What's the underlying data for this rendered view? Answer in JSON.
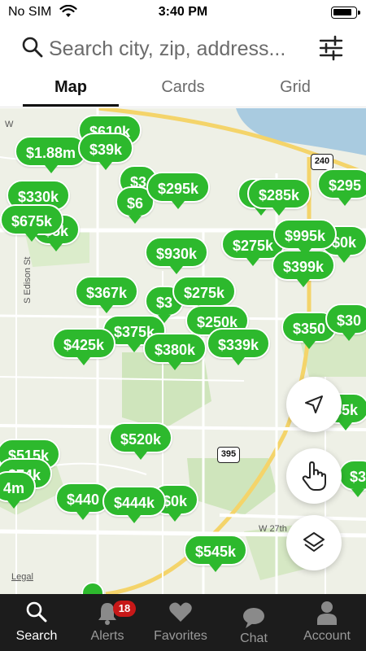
{
  "status_bar": {
    "carrier": "No SIM",
    "time": "3:40 PM"
  },
  "search": {
    "placeholder": "Search city, zip, address..."
  },
  "tabs": [
    {
      "label": "Map",
      "active": true
    },
    {
      "label": "Cards",
      "active": false
    },
    {
      "label": "Grid",
      "active": false
    }
  ],
  "map": {
    "road_labels": {
      "edison": "S Edison St",
      "w27th": "W 27th",
      "w": "W"
    },
    "shields": {
      "route240": "240",
      "route395": "395"
    },
    "legal": "Legal",
    "pins": [
      "$610k",
      "$1.88m",
      "$39k",
      "$330k",
      "$675k",
      "$5k",
      "$3",
      "$295k",
      "$6",
      "$285k",
      "$295",
      "$30",
      "$275k",
      "$995k",
      "$0k",
      "$399k",
      "$930k",
      "$367k",
      "$3",
      "$275k",
      "$250k",
      "$375k",
      "$425k",
      "$380k",
      "$339k",
      "$350",
      "$30",
      "$5k",
      "$520k",
      "$515k",
      "$74k",
      "4m",
      "$440",
      "$444k",
      "$0k",
      "$3",
      "$545k"
    ],
    "controls": {
      "locate": "location-arrow-icon",
      "draw": "hand-pointer-icon",
      "layers": "layers-icon"
    }
  },
  "bottom_nav": [
    {
      "label": "Search",
      "icon": "search-icon",
      "active": true
    },
    {
      "label": "Alerts",
      "icon": "bell-icon",
      "badge": "18",
      "active": false
    },
    {
      "label": "Favorites",
      "icon": "heart-icon",
      "active": false
    },
    {
      "label": "Chat",
      "icon": "chat-icon",
      "active": false
    },
    {
      "label": "Account",
      "icon": "user-icon",
      "active": false
    }
  ],
  "colors": {
    "pin_green": "#2db92d",
    "nav_bg": "#1c1c1c",
    "badge_red": "#c71818",
    "water": "#a9cbe0",
    "park": "#cfe5bc"
  }
}
